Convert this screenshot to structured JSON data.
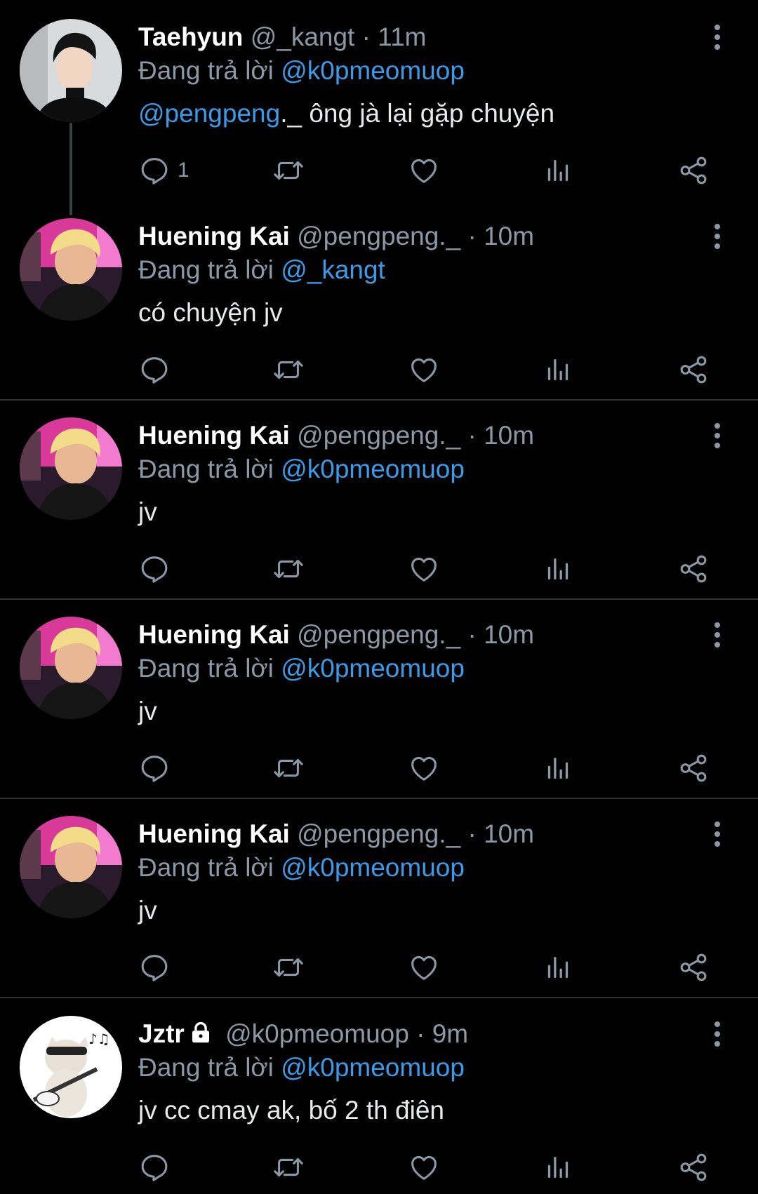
{
  "colors": {
    "background": "#000000",
    "accent": "#3b9be8",
    "muted": "#8b98a5",
    "divider": "#2f3336"
  },
  "icons": [
    "more-vertical-icon",
    "reply-icon",
    "retweet-icon",
    "like-icon",
    "views-icon",
    "share-icon",
    "lock-icon"
  ],
  "tweets": [
    {
      "name": "Taehyun",
      "handle": "@_kangt",
      "separator": "·",
      "time": "11m",
      "reply_prefix": "Đang trả lời",
      "reply_to": "@k0pmeomuop",
      "text_mention": "@pengpeng",
      "text": "._ ông jà lại gặp chuyện",
      "reply_count": "1"
    },
    {
      "name": "Huening Kai",
      "handle": "@pengpeng._",
      "separator": "·",
      "time": "10m",
      "reply_prefix": "Đang trả lời",
      "reply_to": "@_kangt",
      "text": "có chuyện jv"
    },
    {
      "name": "Huening Kai",
      "handle": "@pengpeng._",
      "separator": "·",
      "time": "10m",
      "reply_prefix": "Đang trả lời",
      "reply_to": "@k0pmeomuop",
      "text": "jv"
    },
    {
      "name": "Huening Kai",
      "handle": "@pengpeng._",
      "separator": "·",
      "time": "10m",
      "reply_prefix": "Đang trả lời",
      "reply_to": "@k0pmeomuop",
      "text": "jv"
    },
    {
      "name": "Huening Kai",
      "handle": "@pengpeng._",
      "separator": "·",
      "time": "10m",
      "reply_prefix": "Đang trả lời",
      "reply_to": "@k0pmeomuop",
      "text": "jv"
    },
    {
      "name": "Jztr",
      "handle": "@k0pmeomuop",
      "separator": "·",
      "time": "9m",
      "reply_prefix": "Đang trả lời",
      "reply_to": "@k0pmeomuop",
      "text": "jv cc cmay ak, bố 2 th điên"
    }
  ]
}
